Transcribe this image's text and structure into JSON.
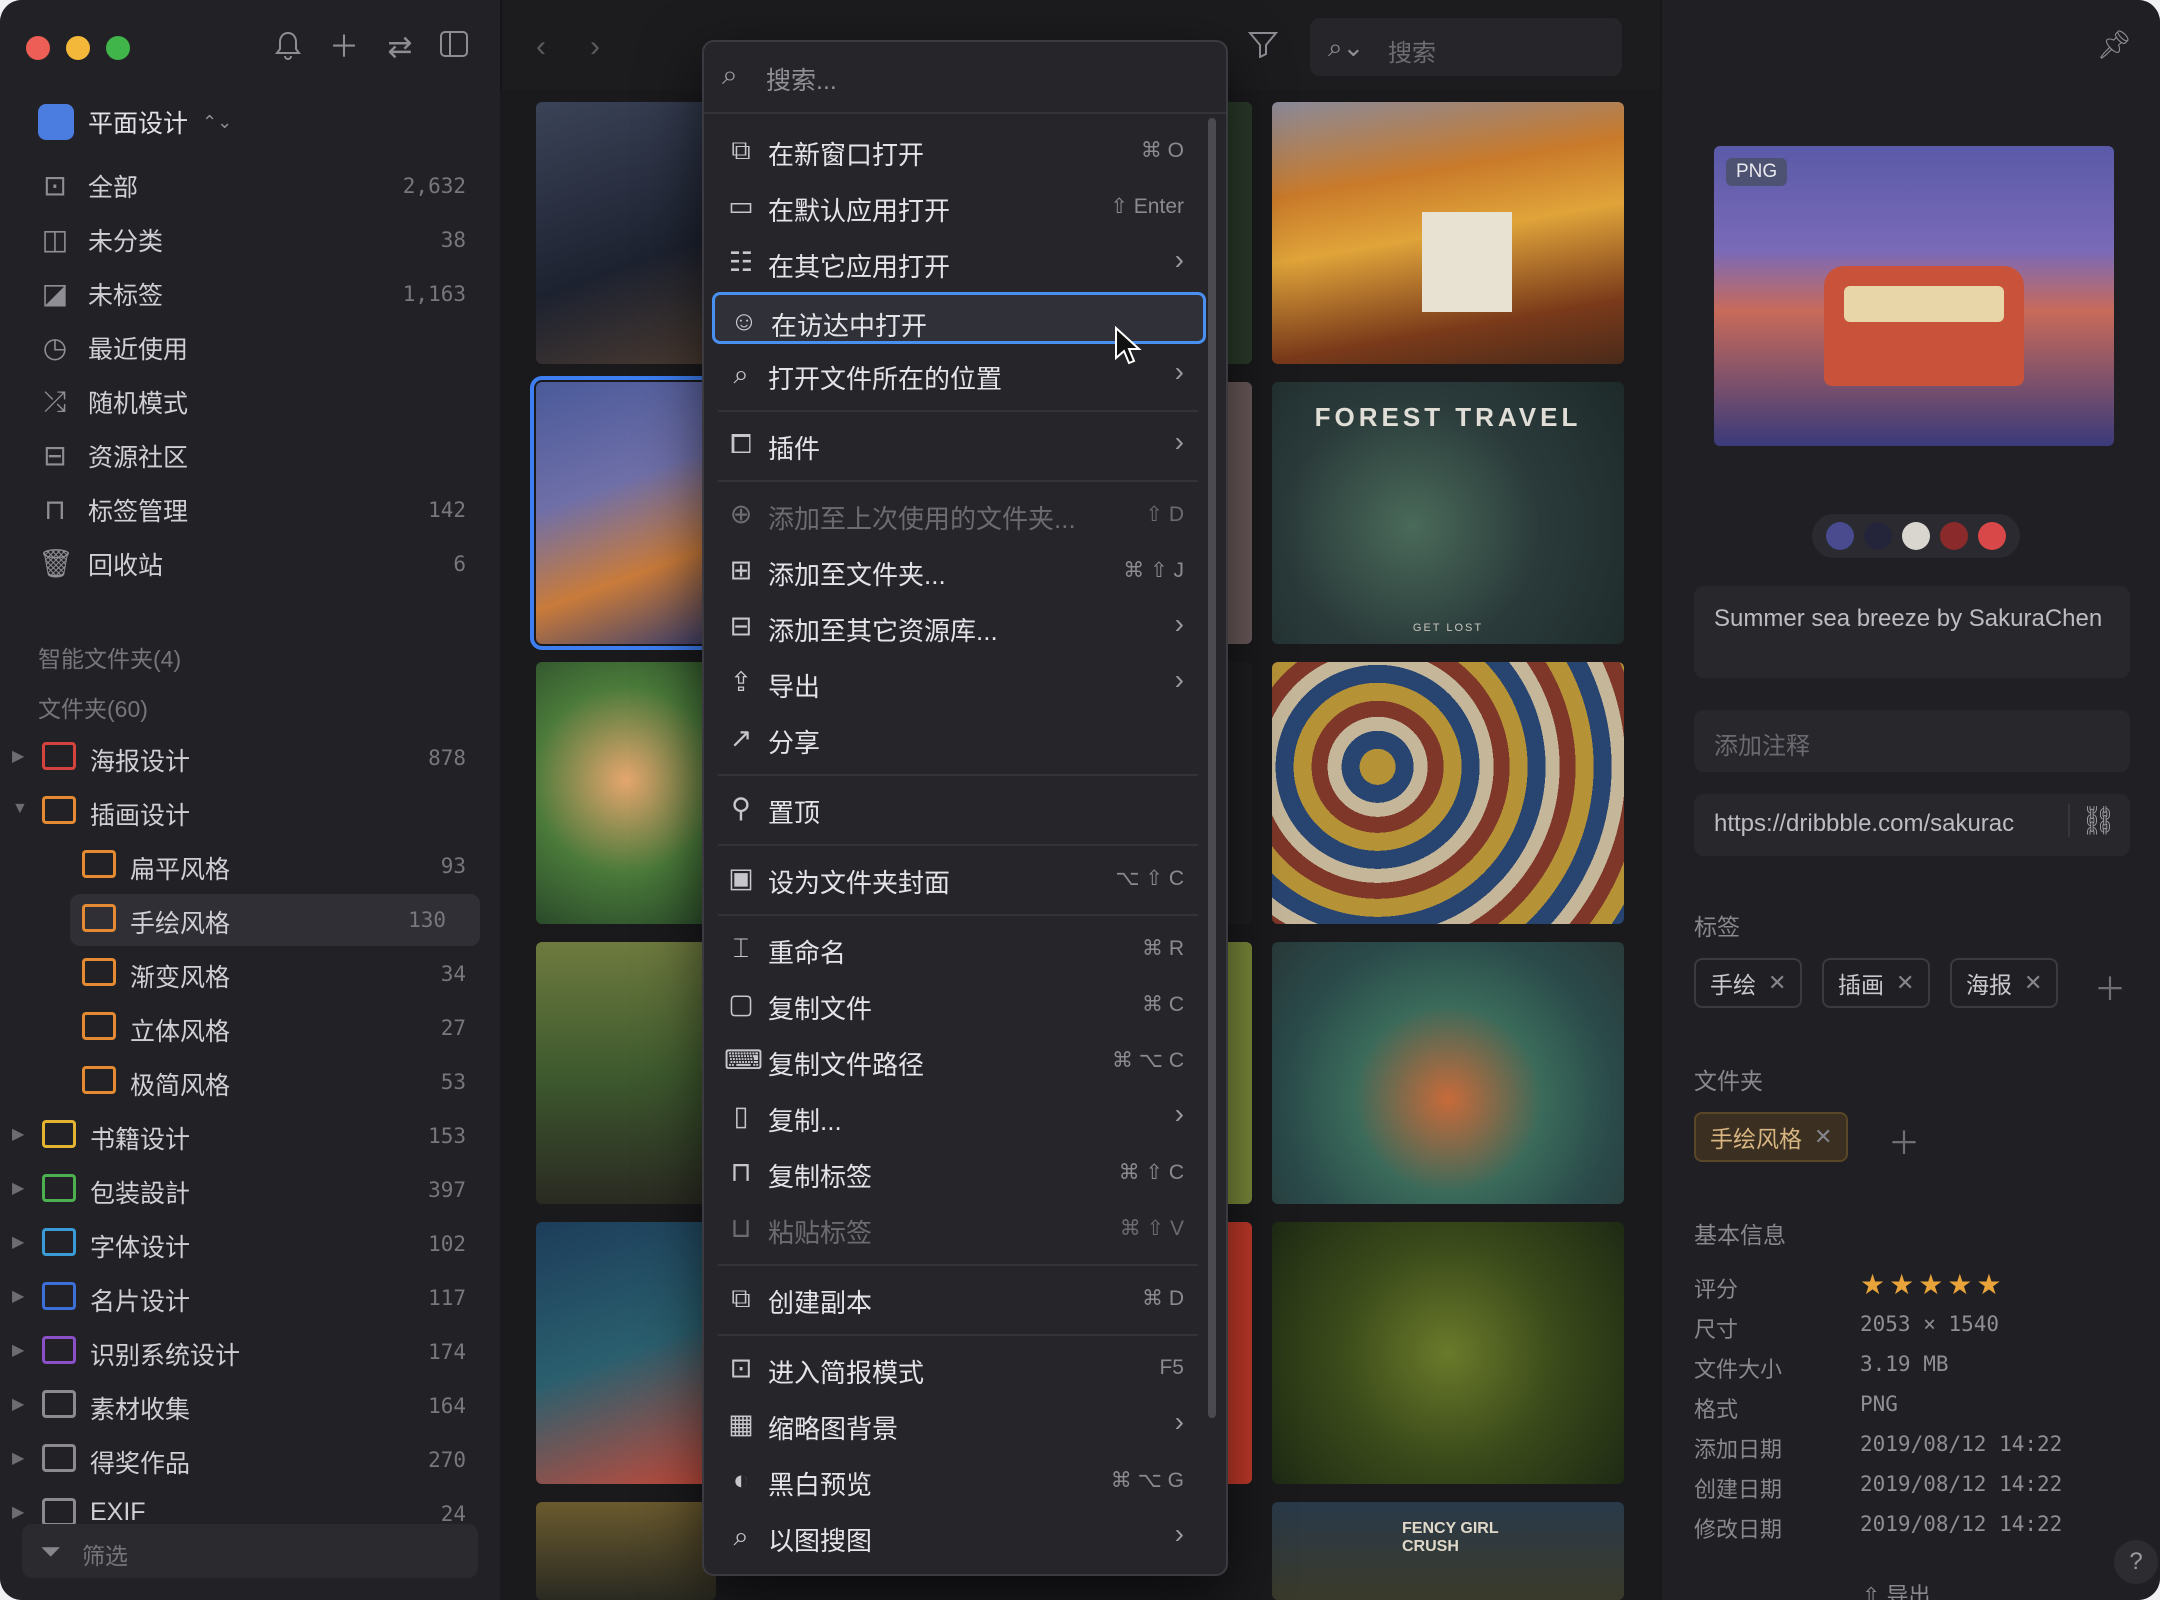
{
  "window": {
    "traffic_colors": [
      "#ec5e56",
      "#f3b83a",
      "#3fb54a"
    ]
  },
  "sidebar": {
    "library": "平面设计",
    "nav": [
      {
        "icon": "inbox-icon",
        "label": "全部",
        "count": "2,632"
      },
      {
        "icon": "uncategorized-icon",
        "label": "未分类",
        "count": "38"
      },
      {
        "icon": "untagged-icon",
        "label": "未标签",
        "count": "1,163"
      },
      {
        "icon": "clock-icon",
        "label": "最近使用",
        "count": ""
      },
      {
        "icon": "shuffle-icon",
        "label": "随机模式",
        "count": ""
      },
      {
        "icon": "community-icon",
        "label": "资源社区",
        "count": ""
      },
      {
        "icon": "bookmark-icon",
        "label": "标签管理",
        "count": "142"
      },
      {
        "icon": "trash-icon",
        "label": "回收站",
        "count": "6"
      }
    ],
    "smart_folders": "智能文件夹(4)",
    "folders_title": "文件夹(60)",
    "folders": [
      {
        "label": "海报设计",
        "count": "878",
        "color": "#d5433e",
        "level": 0,
        "arrow": "right"
      },
      {
        "label": "插画设计",
        "count": "",
        "color": "#e48a33",
        "level": 0,
        "arrow": "down"
      },
      {
        "label": "扁平风格",
        "count": "93",
        "color": "#e48a33",
        "level": 1,
        "arrow": ""
      },
      {
        "label": "手绘风格",
        "count": "130",
        "color": "#e48a33",
        "level": 1,
        "arrow": "",
        "selected": true
      },
      {
        "label": "渐变风格",
        "count": "34",
        "color": "#e48a33",
        "level": 1,
        "arrow": ""
      },
      {
        "label": "立体风格",
        "count": "27",
        "color": "#e48a33",
        "level": 1,
        "arrow": ""
      },
      {
        "label": "极简风格",
        "count": "53",
        "color": "#e48a33",
        "level": 1,
        "arrow": ""
      },
      {
        "label": "书籍设计",
        "count": "153",
        "color": "#e3b432",
        "level": 0,
        "arrow": "right"
      },
      {
        "label": "包装設計",
        "count": "397",
        "color": "#4caf50",
        "level": 0,
        "arrow": "right"
      },
      {
        "label": "字体设计",
        "count": "102",
        "color": "#3a9bd6",
        "level": 0,
        "arrow": "right"
      },
      {
        "label": "名片设计",
        "count": "117",
        "color": "#3c6fd8",
        "level": 0,
        "arrow": "right"
      },
      {
        "label": "识别系统设计",
        "count": "174",
        "color": "#8b4fc8",
        "level": 0,
        "arrow": "right"
      },
      {
        "label": "素材收集",
        "count": "164",
        "color": "#8a8a90",
        "level": 0,
        "arrow": "right"
      },
      {
        "label": "得奖作品",
        "count": "270",
        "color": "#8a8a90",
        "level": 0,
        "arrow": "right"
      },
      {
        "label": "EXIF",
        "count": "24",
        "color": "#8a8a90",
        "level": 0,
        "arrow": "right"
      }
    ],
    "filter": "筛选"
  },
  "toolbar": {
    "search_placeholder": "搜索"
  },
  "thumbs": [
    {
      "name": "FOREST TRAVEL",
      "sub": "GET LOST"
    },
    {
      "name": "FENCY GIRL CRUSH"
    }
  ],
  "menu": {
    "search_placeholder": "搜索...",
    "items": [
      {
        "icon": "new-window-icon",
        "label": "在新窗口打开",
        "shortcut": "⌘ O"
      },
      {
        "icon": "open-app-icon",
        "label": "在默认应用打开",
        "shortcut": "⇧ Enter"
      },
      {
        "icon": "apps-icon",
        "label": "在其它应用打开",
        "submenu": true
      },
      {
        "icon": "finder-icon",
        "label": "在访达中打开",
        "highlight": true
      },
      {
        "icon": "reveal-icon",
        "label": "打开文件所在的位置",
        "submenu": true
      },
      {
        "sep": true
      },
      {
        "icon": "plugin-icon",
        "label": "插件",
        "submenu": true
      },
      {
        "sep": true
      },
      {
        "icon": "folder-add-recent-icon",
        "label": "添加至上次使用的文件夹...",
        "shortcut": "⇧ D",
        "disabled": true
      },
      {
        "icon": "folder-add-icon",
        "label": "添加至文件夹...",
        "shortcut": "⌘ ⇧ J"
      },
      {
        "icon": "library-add-icon",
        "label": "添加至其它资源库...",
        "submenu": true
      },
      {
        "icon": "export-icon",
        "label": "导出",
        "submenu": true
      },
      {
        "icon": "share-icon",
        "label": "分享"
      },
      {
        "sep": true
      },
      {
        "icon": "pin-icon",
        "label": "置顶"
      },
      {
        "sep": true
      },
      {
        "icon": "cover-icon",
        "label": "设为文件夹封面",
        "shortcut": "⌥ ⇧ C"
      },
      {
        "sep": true
      },
      {
        "icon": "rename-icon",
        "label": "重命名",
        "shortcut": "⌘ R"
      },
      {
        "icon": "copy-file-icon",
        "label": "复制文件",
        "shortcut": "⌘ C"
      },
      {
        "icon": "copy-path-icon",
        "label": "复制文件路径",
        "shortcut": "⌘ ⌥ C"
      },
      {
        "icon": "copy-icon",
        "label": "复制...",
        "submenu": true
      },
      {
        "icon": "copy-tags-icon",
        "label": "复制标签",
        "shortcut": "⌘ ⇧ C"
      },
      {
        "icon": "paste-tags-icon",
        "label": "粘贴标签",
        "shortcut": "⌘ ⇧ V",
        "disabled": true
      },
      {
        "sep": true
      },
      {
        "icon": "duplicate-icon",
        "label": "创建副本",
        "shortcut": "⌘ D"
      },
      {
        "sep": true
      },
      {
        "icon": "presentation-icon",
        "label": "进入简报模式",
        "shortcut": "F5"
      },
      {
        "icon": "checker-icon",
        "label": "缩略图背景",
        "submenu": true
      },
      {
        "icon": "grayscale-icon",
        "label": "黑白预览",
        "shortcut": "⌘ ⌥ G"
      },
      {
        "icon": "image-search-icon",
        "label": "以图搜图",
        "submenu": true
      }
    ]
  },
  "inspector": {
    "badge": "PNG",
    "swatches": [
      "#4a4a8e",
      "#24243a",
      "#d9d6d0",
      "#8a2a2a",
      "#d84848"
    ],
    "title": "Summer sea breeze by SakuraChen",
    "note_placeholder": "添加注释",
    "url": "https://dribbble.com/sakurac",
    "tags_label": "标签",
    "tags": [
      "手绘",
      "插画",
      "海报"
    ],
    "folder_label": "文件夹",
    "folder_tag": "手绘风格",
    "info_label": "基本信息",
    "info": [
      {
        "k": "评分",
        "v": "",
        "stars": 5
      },
      {
        "k": "尺寸",
        "v": "2053 × 1540"
      },
      {
        "k": "文件大小",
        "v": "3.19 MB"
      },
      {
        "k": "格式",
        "v": "PNG"
      },
      {
        "k": "添加日期",
        "v": "2019/08/12 14:22"
      },
      {
        "k": "创建日期",
        "v": "2019/08/12 14:22"
      },
      {
        "k": "修改日期",
        "v": "2019/08/12 14:22"
      }
    ],
    "export": "导出",
    "help": "?"
  }
}
